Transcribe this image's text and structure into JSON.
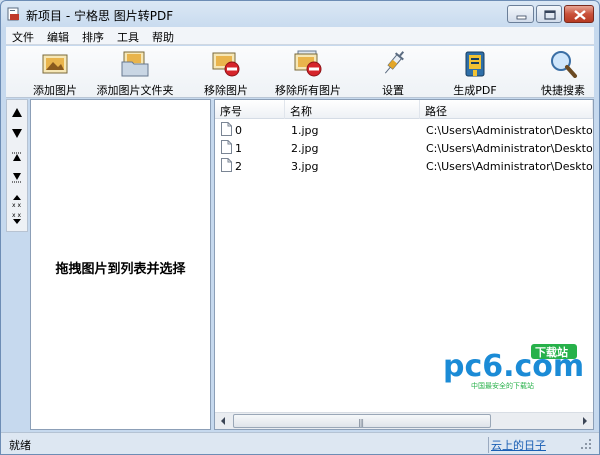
{
  "window": {
    "title": "新项目 - 宁格思 图片转PDF"
  },
  "menu": [
    "文件",
    "编辑",
    "排序",
    "工具",
    "帮助"
  ],
  "toolbar": [
    {
      "label": "添加图片",
      "icon": "add-image-icon"
    },
    {
      "label": "添加图片文件夹",
      "icon": "add-folder-icon"
    },
    {
      "label": "移除图片",
      "icon": "remove-image-icon"
    },
    {
      "label": "移除所有图片",
      "icon": "remove-all-icon"
    },
    {
      "label": "设置",
      "icon": "settings-syringe-icon"
    },
    {
      "label": "生成PDF",
      "icon": "generate-pdf-icon"
    },
    {
      "label": "快捷搜素",
      "icon": "magnifier-icon"
    }
  ],
  "drop_panel": {
    "hint": "拖拽图片到列表并选择"
  },
  "list": {
    "columns": [
      "序号",
      "名称",
      "路径"
    ],
    "rows": [
      {
        "index": "0",
        "name": "1.jpg",
        "path": "C:\\Users\\Administrator\\Desktop"
      },
      {
        "index": "1",
        "name": "2.jpg",
        "path": "C:\\Users\\Administrator\\Desktop"
      },
      {
        "index": "2",
        "name": "3.jpg",
        "path": "C:\\Users\\Administrator\\Desktop"
      }
    ]
  },
  "watermark": {
    "brand": "pc6.com",
    "badge": "下载站",
    "tagline": "中国最安全的下载站"
  },
  "status": {
    "text": "就绪",
    "link": "云上的日子"
  },
  "colors": {
    "accent": "#1a5fb4",
    "watermark_blue": "#1b8bd6",
    "watermark_green": "#27b14a"
  }
}
